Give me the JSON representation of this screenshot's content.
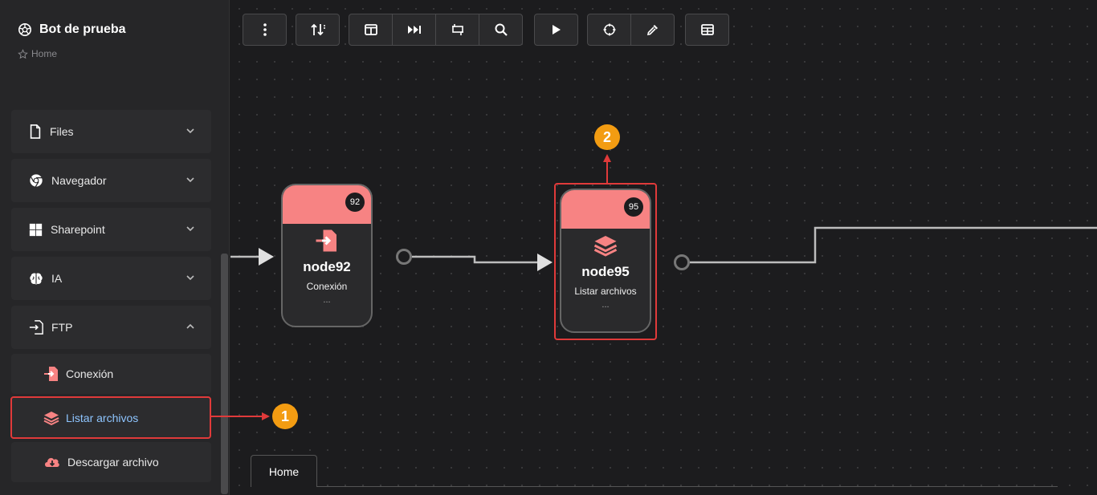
{
  "app": {
    "title": "Bot de prueba",
    "breadcrumb": "Home"
  },
  "sidebar": {
    "categories": [
      {
        "label": "Files",
        "icon": "file-icon",
        "expanded": false
      },
      {
        "label": "Navegador",
        "icon": "chrome-icon",
        "expanded": false
      },
      {
        "label": "Sharepoint",
        "icon": "windows-icon",
        "expanded": false
      },
      {
        "label": "IA",
        "icon": "brain-icon",
        "expanded": false
      },
      {
        "label": "FTP",
        "icon": "ftp-icon",
        "expanded": true
      }
    ],
    "ftp_items": [
      {
        "label": "Conexión",
        "icon": "file-import-icon"
      },
      {
        "label": "Listar archivos",
        "icon": "layers-icon",
        "active": true
      },
      {
        "label": "Descargar archivo",
        "icon": "cloud-download-icon"
      }
    ]
  },
  "toolbar": [
    "more-vertical-icon",
    "sort-icon",
    "columns-icon",
    "fast-forward-icon",
    "transform-icon",
    "search-icon",
    "play-icon",
    "crosshair-icon",
    "eyedropper-icon",
    "table-icon"
  ],
  "nodes": [
    {
      "id": "92",
      "name": "node92",
      "type": "Conexión",
      "more": "...",
      "icon": "file-import-icon"
    },
    {
      "id": "95",
      "name": "node95",
      "type": "Listar archivos",
      "more": "...",
      "icon": "layers-icon"
    }
  ],
  "callouts": [
    "1",
    "2"
  ],
  "tabs": [
    {
      "label": "Home"
    }
  ],
  "colors": {
    "accent": "#f78383",
    "highlight": "#e03a3a",
    "callout": "#f39c12",
    "active_text": "#8ec5ff"
  }
}
